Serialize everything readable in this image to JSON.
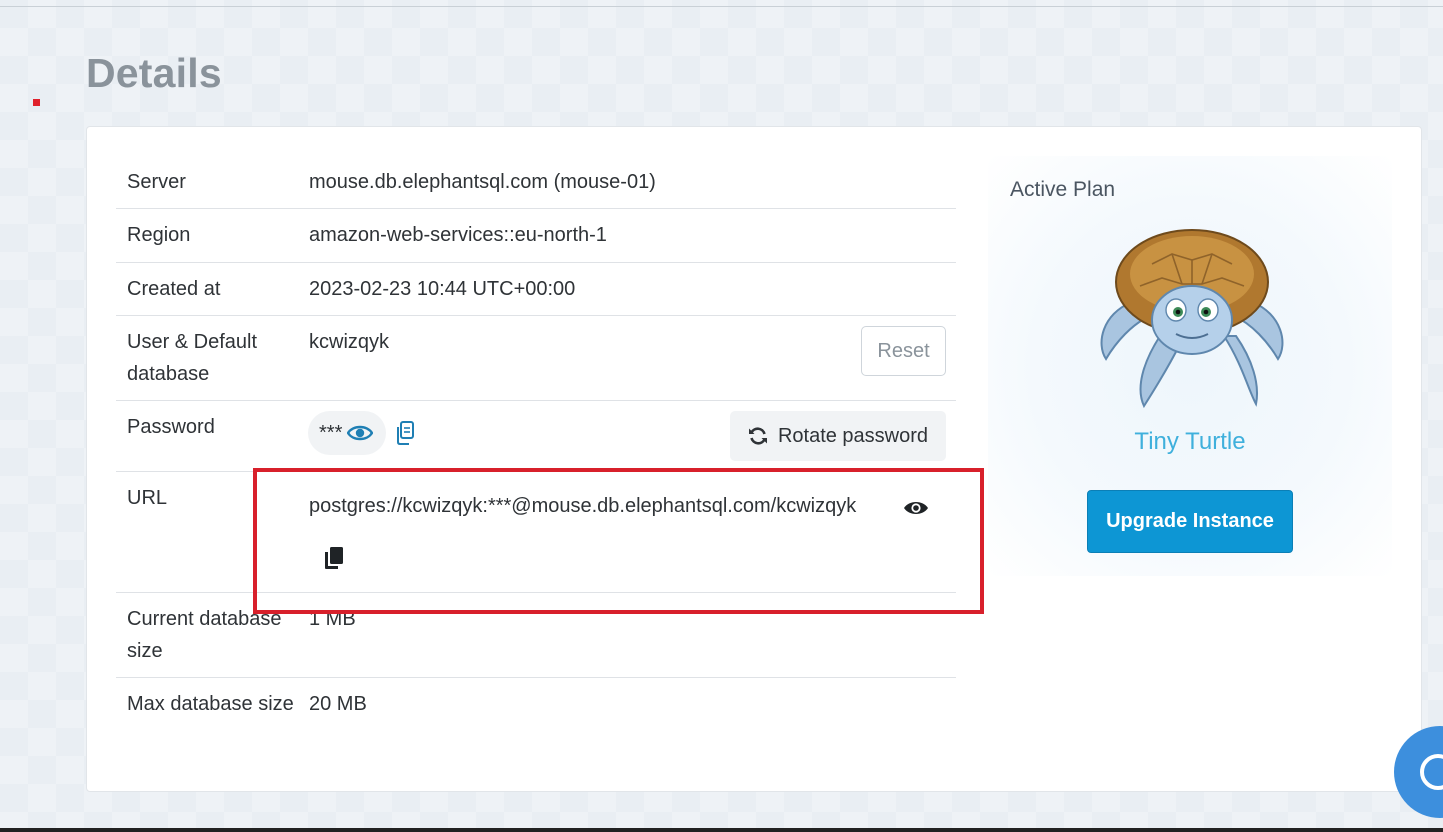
{
  "page": {
    "title": "Details"
  },
  "details": {
    "server": {
      "label": "Server",
      "value": "mouse.db.elephantsql.com (mouse-01)"
    },
    "region": {
      "label": "Region",
      "value": "amazon-web-services::eu-north-1"
    },
    "created_at": {
      "label": "Created at",
      "value": "2023-02-23 10:44 UTC+00:00"
    },
    "user": {
      "label": "User & Default database",
      "value": "kcwizqyk",
      "reset_label": "Reset"
    },
    "password": {
      "label": "Password",
      "masked": "***",
      "rotate_label": "Rotate password"
    },
    "url": {
      "label": "URL",
      "value": "postgres://kcwizqyk:***@mouse.db.elephantsql.com/kcwizqyk"
    },
    "current_size": {
      "label": "Current database size",
      "value": "1 MB"
    },
    "max_size": {
      "label": "Max database size",
      "value": "20 MB"
    }
  },
  "plan": {
    "heading": "Active Plan",
    "name": "Tiny Turtle",
    "upgrade_label": "Upgrade Instance"
  },
  "icons": {
    "eye": "eye-icon",
    "copy": "copy-icon",
    "rotate": "refresh-icon",
    "chat": "chat-icon"
  },
  "colors": {
    "accent": "#0d96d4",
    "plan_name": "#3fb0dc",
    "highlight": "#d8202b"
  }
}
